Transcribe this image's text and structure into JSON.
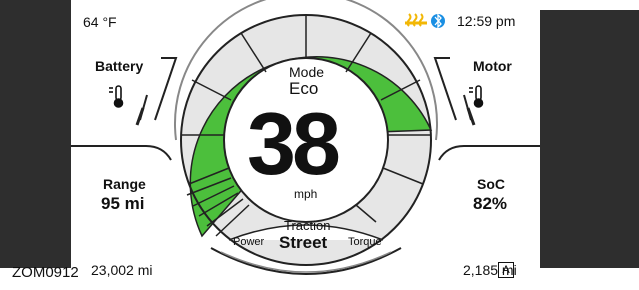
{
  "status_bar": {
    "temperature": "64 °F",
    "time": "12:59 pm",
    "icons": [
      "heated-grips-icon",
      "bluetooth-icon"
    ],
    "heated_color": "#f2b705",
    "bluetooth_color": "#1a8fe3"
  },
  "left_panel": {
    "battery_label": "Battery",
    "battery_icon": "thermometer-icon",
    "range_label": "Range",
    "range_value": "95 mi",
    "odometer": "23,002 mi"
  },
  "right_panel": {
    "motor_label": "Motor",
    "motor_icon": "thermometer-icon",
    "soc_label": "SoC",
    "soc_value": "82%",
    "trip_label": "A",
    "trip_value": "2,185 mi"
  },
  "center": {
    "mode_label": "Mode",
    "mode_value": "Eco",
    "speed": "38",
    "speed_unit": "mph",
    "traction_label": "Traction",
    "traction_value": "Street",
    "power_label": "Power",
    "torque_label": "Torque"
  },
  "colors": {
    "gauge_green": "#4cbf3c",
    "gauge_gray": "#e6e6e6",
    "frame_dark": "#2e2e2e"
  },
  "figure_ref": "ZOM0912"
}
